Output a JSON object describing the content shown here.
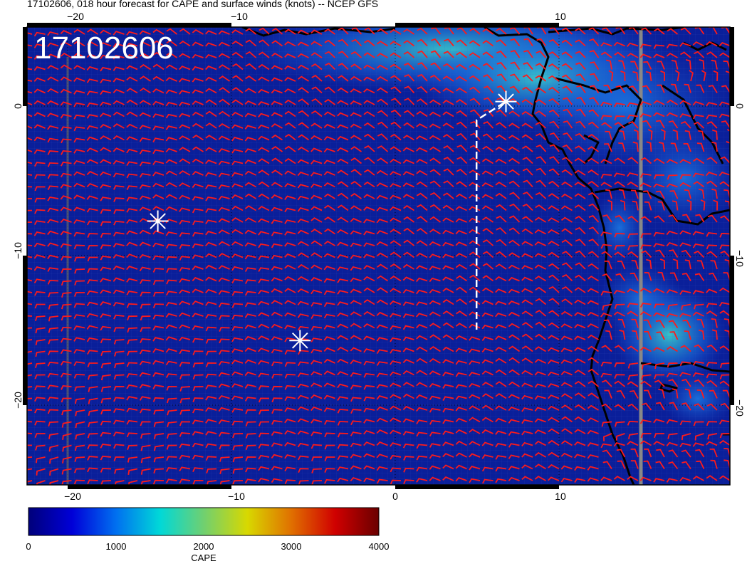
{
  "title": "17102606, 018 hour forecast for CAPE and surface winds (knots) -- NCEP GFS",
  "stamp": "17102606",
  "x_ticks": [
    "−20",
    "−10",
    "0",
    "10"
  ],
  "y_ticks": [
    "0",
    "−10",
    "−20"
  ],
  "colorbar": {
    "title": "CAPE",
    "labels": [
      "0",
      "1000",
      "2000",
      "3000",
      "4000"
    ],
    "range": [
      0,
      4000
    ],
    "colors": [
      "#00007a",
      "#0000d8",
      "#0070f0",
      "#00d8d8",
      "#70d070",
      "#d8d800",
      "#e07000",
      "#d00000",
      "#6a0000"
    ]
  },
  "map": {
    "lon_range": [
      -22.5,
      20.5
    ],
    "lat_range": [
      -24.5,
      5
    ],
    "ocean_color": "#0a1f9a",
    "wind_barb_color": "#ff1a1a",
    "coast_color": "#000000",
    "markers": [
      {
        "label": "storm-marker",
        "lon": -14.5,
        "lat": -7.5
      },
      {
        "label": "storm-marker",
        "lon": -5.8,
        "lat": -15.2
      },
      {
        "label": "storm-marker",
        "lon": 6.8,
        "lat": 0.2
      }
    ],
    "track": [
      [
        5,
        -14.5
      ],
      [
        5,
        -1
      ],
      [
        6.8,
        0.2
      ]
    ]
  }
}
